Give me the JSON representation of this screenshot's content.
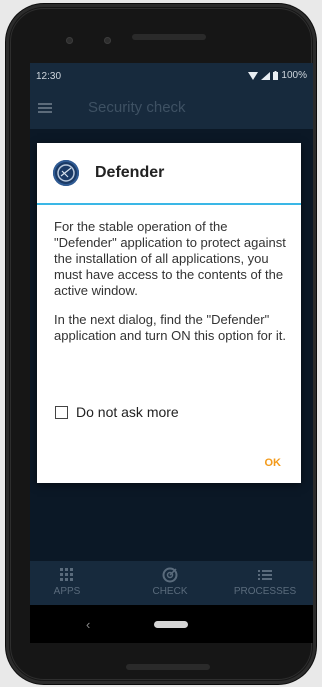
{
  "status_bar": {
    "time": "12:30",
    "battery": "100%"
  },
  "app_bar": {
    "title": "Security check",
    "menu_icon": "hamburger-menu-icon"
  },
  "dialog": {
    "title": "Defender",
    "body_p1": "For the stable operation of the \"Defender\" application to protect against the installation of all applications, you must have access to the contents of the active window.",
    "body_p2": "In the next dialog, find the \"Defender\" application and turn ON this option for it.",
    "checkbox_label": "Do not ask more",
    "checkbox_checked": false,
    "ok_label": "OK",
    "accent_color": "#3ab7e6",
    "ok_color": "#f39a1a"
  },
  "bottom_nav": {
    "items": [
      {
        "label": "APPS",
        "icon": "apps-grid-icon"
      },
      {
        "label": "CHECK",
        "icon": "radar-check-icon"
      },
      {
        "label": "PROCESSES",
        "icon": "list-icon"
      }
    ]
  },
  "system_nav": {
    "back_icon": "back-chevron-icon",
    "home_icon": "home-pill-icon"
  }
}
